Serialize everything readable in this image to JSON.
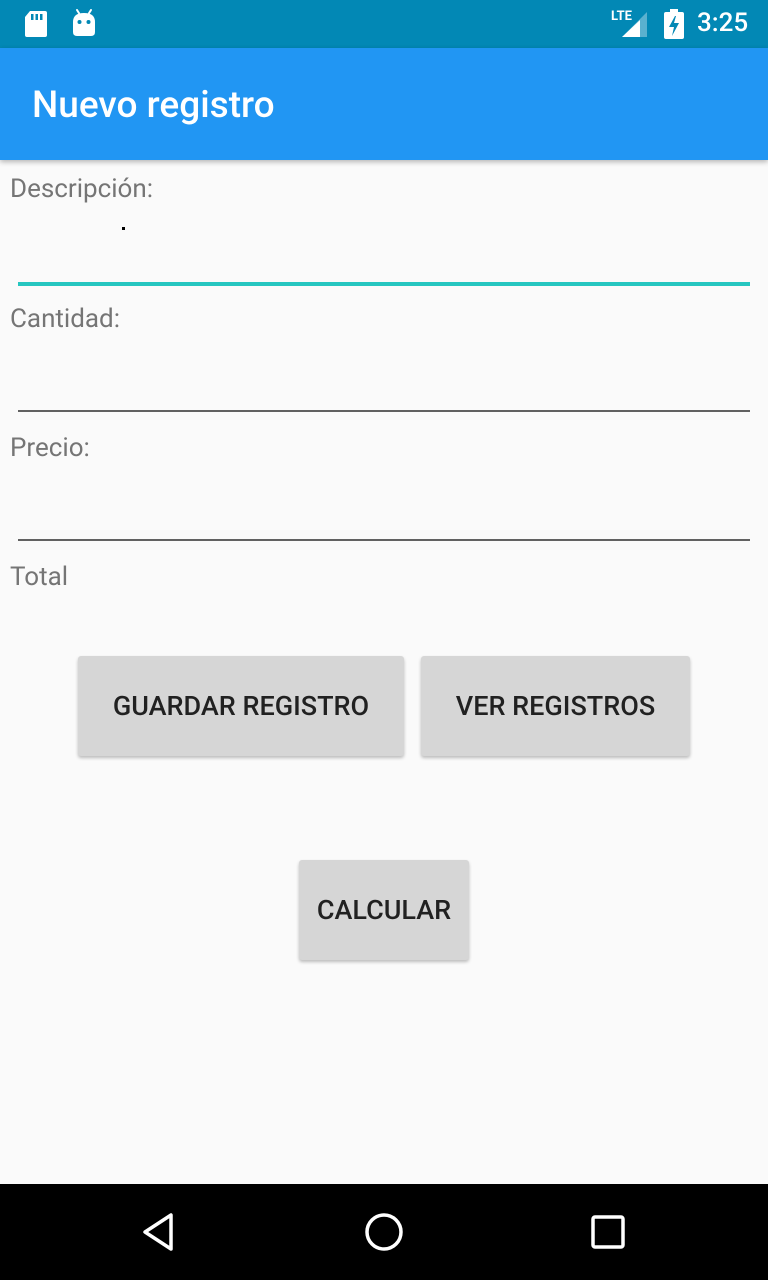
{
  "status_bar": {
    "time": "3:25",
    "network_label": "LTE",
    "icons": [
      "sd-card-icon",
      "android-icon",
      "signal-icon",
      "battery-charging-icon"
    ]
  },
  "app_bar": {
    "title": "Nuevo registro",
    "color": "#2196f3"
  },
  "form": {
    "descripcion": {
      "label": "Descripción:",
      "value": ""
    },
    "cantidad": {
      "label": "Cantidad:",
      "value": ""
    },
    "precio": {
      "label": "Precio:",
      "value": ""
    },
    "total_label": "Total",
    "accent_color": "#26c6c0"
  },
  "buttons": {
    "guardar": "GUARDAR REGISTRO",
    "ver": "VER REGISTROS",
    "calcular": "CALCULAR"
  },
  "nav_bar": {
    "icons": [
      "back-icon",
      "home-icon",
      "recents-icon"
    ]
  }
}
